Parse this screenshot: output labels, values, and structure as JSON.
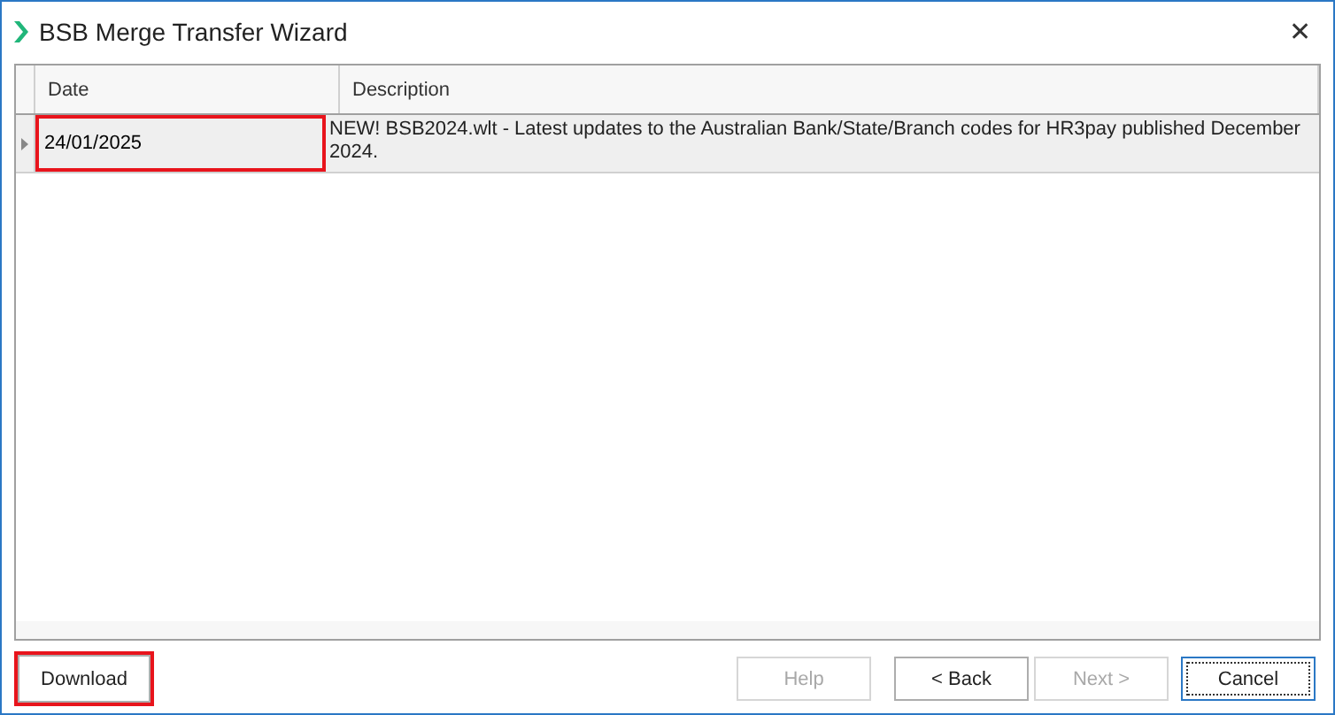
{
  "window": {
    "title": "BSB Merge Transfer Wizard",
    "close": "✕"
  },
  "table": {
    "columns": [
      "Date",
      "Description"
    ],
    "rows": [
      {
        "selected": true,
        "highlighted": true,
        "cells": [
          "24/01/2025",
          "NEW! BSB2024.wlt - Latest updates to the Australian Bank/State/Branch codes for HR3pay published December 2024."
        ]
      }
    ]
  },
  "buttons": [
    {
      "label": "Download",
      "disabled": false,
      "focused": false,
      "highlighted": true
    },
    {
      "label": "Help",
      "disabled": true,
      "focused": false,
      "highlighted": false
    },
    {
      "label": "< Back",
      "disabled": false,
      "focused": false,
      "highlighted": false
    },
    {
      "label": "Next >",
      "disabled": true,
      "focused": false,
      "highlighted": false
    },
    {
      "label": "Cancel",
      "disabled": false,
      "focused": true,
      "highlighted": false
    }
  ]
}
